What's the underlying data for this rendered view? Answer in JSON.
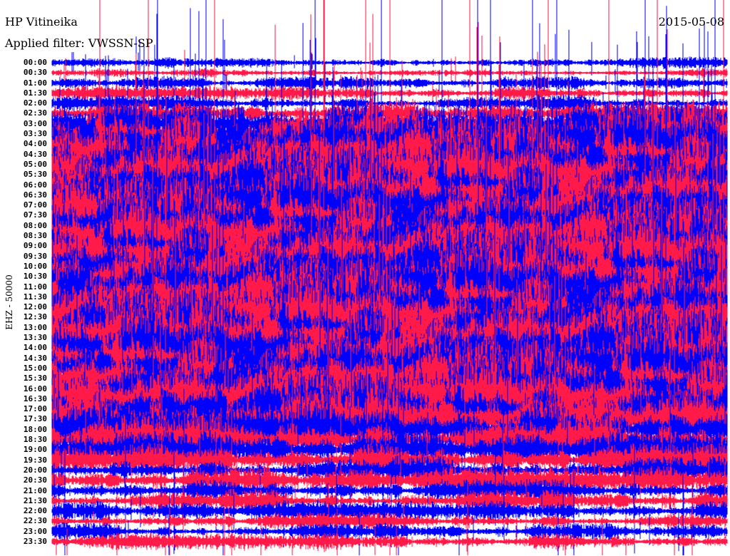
{
  "header": {
    "station": "HP Vitineika",
    "filter": "Applied filter: VWSSN-SP",
    "date": "2015-05-08"
  },
  "chart_data": {
    "type": "line",
    "subtype": "helicorder",
    "title": "HP Vitineika",
    "ylabel": "EHZ - 50000",
    "row_labels": [
      "00:00",
      "00:30",
      "01:00",
      "01:30",
      "02:00",
      "02:30",
      "03:00",
      "03:30",
      "04:00",
      "04:30",
      "05:00",
      "05:30",
      "06:00",
      "06:30",
      "07:00",
      "07:30",
      "08:00",
      "08:30",
      "09:00",
      "09:30",
      "10:00",
      "10:30",
      "11:00",
      "11:30",
      "12:00",
      "12:30",
      "13:00",
      "13:30",
      "14:00",
      "14:30",
      "15:00",
      "15:30",
      "16:00",
      "16:30",
      "17:00",
      "17:30",
      "18:00",
      "18:30",
      "19:00",
      "19:30",
      "20:00",
      "20:30",
      "21:00",
      "21:30",
      "22:00",
      "22:30",
      "23:00",
      "23:30"
    ],
    "series_colors": [
      "#0000ff",
      "#ff1a4a"
    ],
    "relative_amplitude": [
      1,
      1,
      1.2,
      1.3,
      1.5,
      2,
      4,
      6,
      7,
      7,
      7,
      7,
      7,
      7,
      7,
      7,
      7,
      7,
      7,
      7,
      7,
      7,
      7,
      7,
      7,
      7,
      7,
      7,
      7,
      7,
      7,
      7,
      7,
      7,
      6.5,
      6,
      5,
      4.5,
      3.5,
      3,
      2.5,
      2.5,
      2,
      2,
      1.8,
      1.6,
      1.5,
      1.5
    ]
  }
}
